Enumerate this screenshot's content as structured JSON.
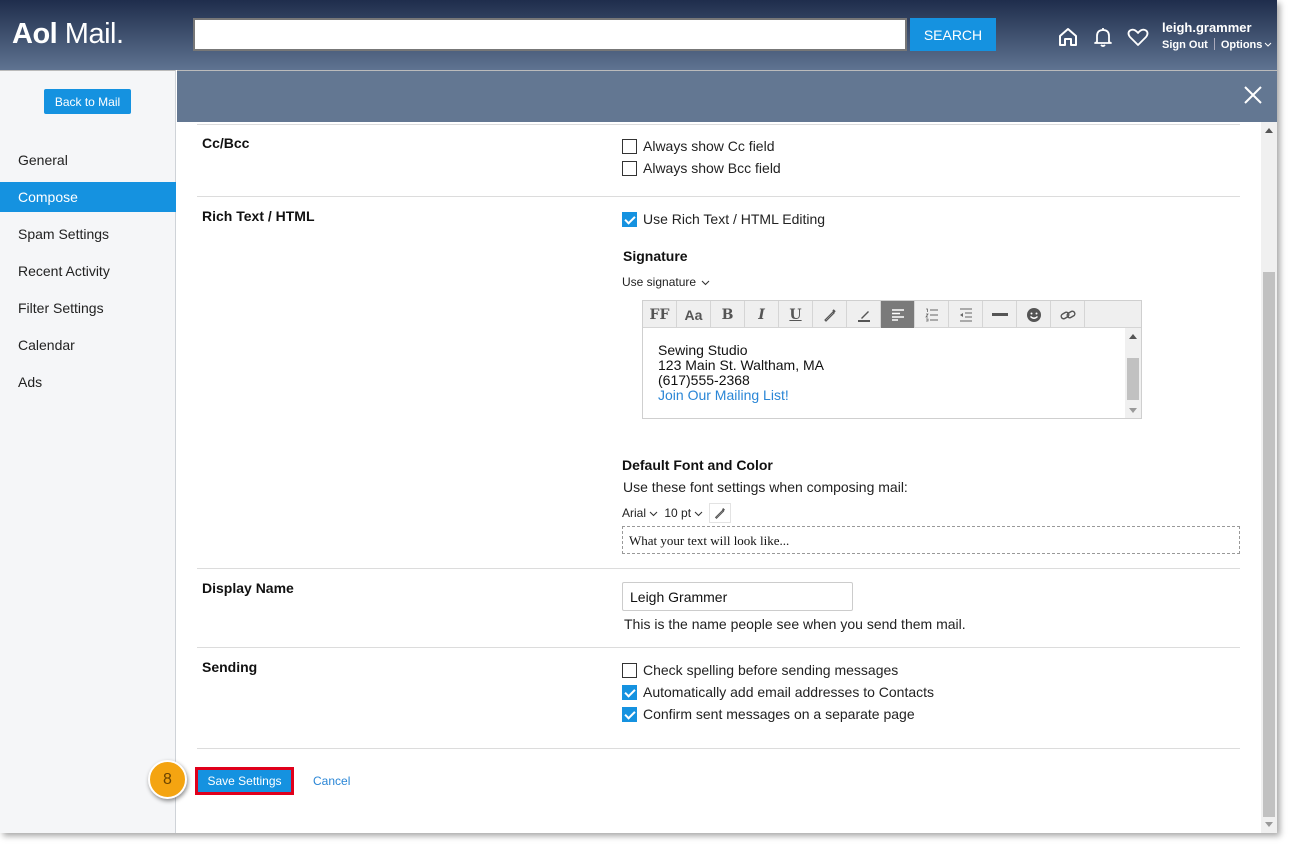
{
  "header": {
    "logo_bold": "Aol",
    "logo_light": "Mail.",
    "search_value": "",
    "search_button": "SEARCH",
    "icons": [
      "home-icon",
      "bell-icon",
      "heart-icon"
    ],
    "username": "leigh.grammer",
    "sign_out": "Sign Out",
    "options": "Options"
  },
  "sidebar": {
    "back_button": "Back to Mail",
    "items": [
      {
        "label": "General",
        "active": false
      },
      {
        "label": "Compose",
        "active": true
      },
      {
        "label": "Spam Settings",
        "active": false
      },
      {
        "label": "Recent Activity",
        "active": false
      },
      {
        "label": "Filter Settings",
        "active": false
      },
      {
        "label": "Calendar",
        "active": false
      },
      {
        "label": "Ads",
        "active": false
      }
    ]
  },
  "sections": {
    "ccbcc": {
      "label": "Cc/Bcc",
      "options": [
        {
          "label": "Always show Cc field",
          "checked": false
        },
        {
          "label": "Always show Bcc field",
          "checked": false
        }
      ]
    },
    "richtext": {
      "label": "Rich Text / HTML",
      "option": {
        "label": "Use Rich Text / HTML Editing",
        "checked": true
      },
      "signature_heading": "Signature",
      "signature_dropdown": "Use signature",
      "toolbar": [
        "font-family",
        "font-size",
        "bold",
        "italic",
        "underline",
        "text-color",
        "highlight",
        "align-left",
        "numbered-list",
        "indent",
        "horizontal-rule",
        "emoji",
        "link"
      ],
      "toolbar_labels": {
        "font_family": "FF",
        "font_size": "Aa",
        "bold": "B",
        "italic": "I",
        "underline": "U"
      },
      "signature_lines": [
        "Sewing Studio",
        "123 Main St. Waltham, MA",
        "(617)555-2368"
      ],
      "signature_link": "Join Our Mailing List!",
      "font_heading": "Default Font and Color",
      "font_desc": "Use these font settings when composing mail:",
      "font_family": "Arial",
      "font_size": "10 pt",
      "preview_text": "What your text will look like..."
    },
    "display_name": {
      "label": "Display Name",
      "value": "Leigh Grammer",
      "help": "This is the name people see when you send them mail."
    },
    "sending": {
      "label": "Sending",
      "options": [
        {
          "label": "Check spelling before sending messages",
          "checked": false
        },
        {
          "label": "Automatically add email addresses to Contacts",
          "checked": true
        },
        {
          "label": "Confirm sent messages on a separate page",
          "checked": true
        }
      ]
    }
  },
  "footer": {
    "save": "Save Settings",
    "cancel": "Cancel",
    "step_number": "8"
  },
  "colors": {
    "accent": "#1592e0",
    "highlight_border": "#e0001b",
    "step_badge": "#f4a411",
    "panel_header": "#637792"
  }
}
